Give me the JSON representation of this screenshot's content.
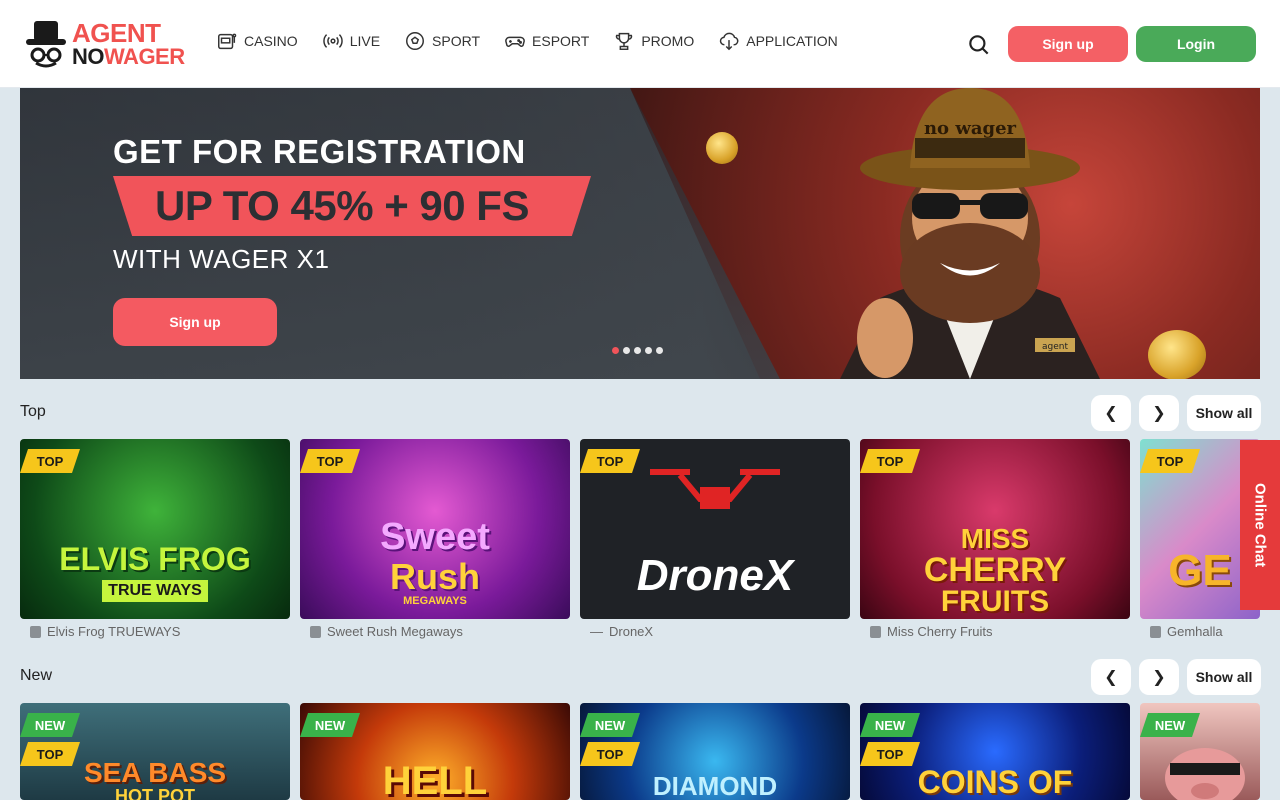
{
  "brand": {
    "line1": "AGENT",
    "line2_a": "NO",
    "line2_b": "WAGER"
  },
  "nav": [
    {
      "label": "CASINO",
      "icon": "slot-machine-icon"
    },
    {
      "label": "LIVE",
      "icon": "broadcast-icon"
    },
    {
      "label": "SPORT",
      "icon": "soccer-ball-icon"
    },
    {
      "label": "ESPORT",
      "icon": "gamepad-icon"
    },
    {
      "label": "PROMO",
      "icon": "trophy-icon"
    },
    {
      "label": "APPLICATION",
      "icon": "download-cloud-icon"
    }
  ],
  "header": {
    "signup": "Sign up",
    "login": "Login"
  },
  "banner": {
    "title": "GET FOR REGISTRATION",
    "offer": "UP TO 45% + 90 FS",
    "sub": "WITH WAGER X1",
    "cta": "Sign up",
    "hat_text": "no wager",
    "badge_text": "agent"
  },
  "sections": {
    "top": {
      "title": "Top",
      "show_all": "Show all",
      "games": [
        {
          "name": "Elvis Frog TRUEWAYS",
          "badges": [
            "TOP"
          ],
          "art_line1": "ELVIS FROG",
          "art_line2": "TRUE WAYS",
          "provider": "B"
        },
        {
          "name": "Sweet Rush Megaways",
          "badges": [
            "TOP"
          ],
          "art_line1": "Sweet",
          "art_line2": "Rush",
          "art_line3": "MEGAWAYS",
          "provider": "B"
        },
        {
          "name": "DroneX",
          "badges": [
            "TOP"
          ],
          "art_line1": "DroneX",
          "provider": "—"
        },
        {
          "name": "Miss Cherry Fruits",
          "badges": [
            "TOP"
          ],
          "art_line1": "MISS",
          "art_line2": "CHERRY",
          "art_line3": "FRUITS",
          "provider": "B"
        },
        {
          "name": "Gemhalla",
          "badges": [
            "TOP"
          ],
          "art_line1": "GE",
          "provider": "B"
        }
      ]
    },
    "new": {
      "title": "New",
      "show_all": "Show all",
      "games": [
        {
          "badges": [
            "NEW",
            "TOP"
          ],
          "art_line1": "SEA BASS",
          "art_line2": "HOT POT"
        },
        {
          "badges": [
            "NEW"
          ],
          "art_line1": "HELL"
        },
        {
          "badges": [
            "NEW",
            "TOP"
          ],
          "art_line1": "DIAMOND"
        },
        {
          "badges": [
            "NEW",
            "TOP"
          ],
          "art_line1": "COINS OF"
        },
        {
          "badges": [
            "NEW"
          ],
          "art_line1": ""
        }
      ]
    }
  },
  "online_chat": "Online Chat"
}
